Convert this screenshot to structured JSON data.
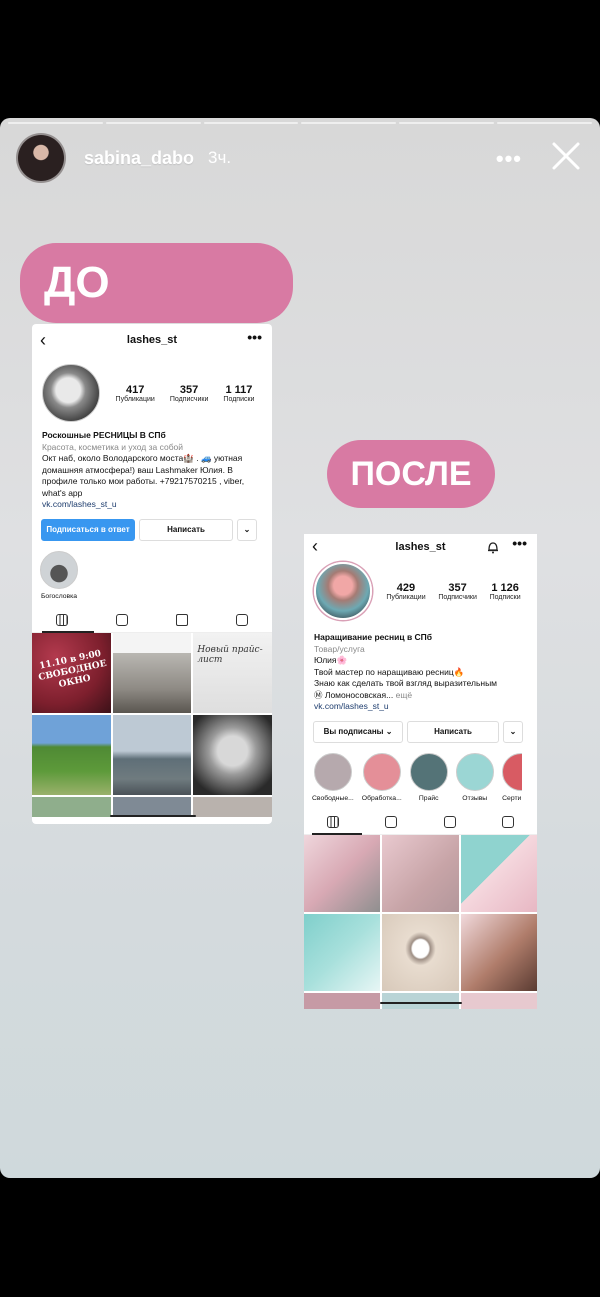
{
  "story": {
    "username": "sabina_dabo",
    "time": "3ч.",
    "label_before": "ДО",
    "label_after": "ПОСЛЕ"
  },
  "before": {
    "username": "lashes_st",
    "stats": [
      {
        "n": "417",
        "l": "Публикации"
      },
      {
        "n": "357",
        "l": "Подписчики"
      },
      {
        "n": "1 117",
        "l": "Подписки"
      }
    ],
    "name": "Роскошные РЕСНИЦЫ В СПб",
    "category": "Красота, косметика и уход за собой",
    "bio": "Окт наб, около Володарского моста🏰 . 🚙 уютная домашняя атмосфера!) ваш Lashmaker Юлия. В профиле только мои работы. +79217570215 , viber, what's app",
    "link": "vk.com/lashes_st_u",
    "btn_follow": "Подписаться в ответ",
    "btn_message": "Написать",
    "highlight": "Богословка",
    "grid_text_1": "11.10 в 9:00\nСВОБОДНОЕ\nОКНО",
    "grid_text_2": "Новый прайс-лист"
  },
  "after": {
    "username": "lashes_st",
    "stats": [
      {
        "n": "429",
        "l": "Публикации"
      },
      {
        "n": "357",
        "l": "Подписчики"
      },
      {
        "n": "1 126",
        "l": "Подписки"
      }
    ],
    "name": "Наращивание ресниц в СПб",
    "category": "Товар/услуга",
    "bio_line1": "Юлия🌸",
    "bio_line2": "Твой мастер по наращиваю ресниц🔥",
    "bio_line3": "Знаю как сделать твой взгляд выразительным",
    "bio_line4": "Ⓜ Ломоносовская...",
    "bio_more": "ещё",
    "link": "vk.com/lashes_st_u",
    "btn_following": "Вы подписаны ⌄",
    "btn_message": "Написать",
    "highlights": [
      "Свободные...",
      "Обработка...",
      "Прайс",
      "Отзывы",
      "Серти"
    ],
    "highlight_colors": [
      "#b6a9ad",
      "#e48f98",
      "#547377",
      "#9bd6d4",
      "#d85b63"
    ]
  }
}
